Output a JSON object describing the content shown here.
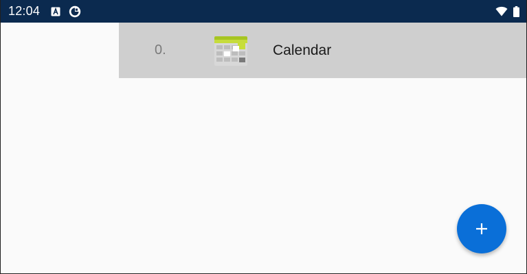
{
  "status_bar": {
    "time": "12:04",
    "icons": [
      "autofill-a-icon",
      "data-saver-icon",
      "wifi-icon",
      "battery-icon"
    ],
    "background_color": "#0b2a4f"
  },
  "list": {
    "items": [
      {
        "index": "0.",
        "icon": "calendar-app-icon",
        "label": "Calendar",
        "selected": true
      }
    ],
    "selected_row_color": "#cfcfcf"
  },
  "fab": {
    "icon": "plus-icon",
    "color": "#0a6fd8"
  }
}
